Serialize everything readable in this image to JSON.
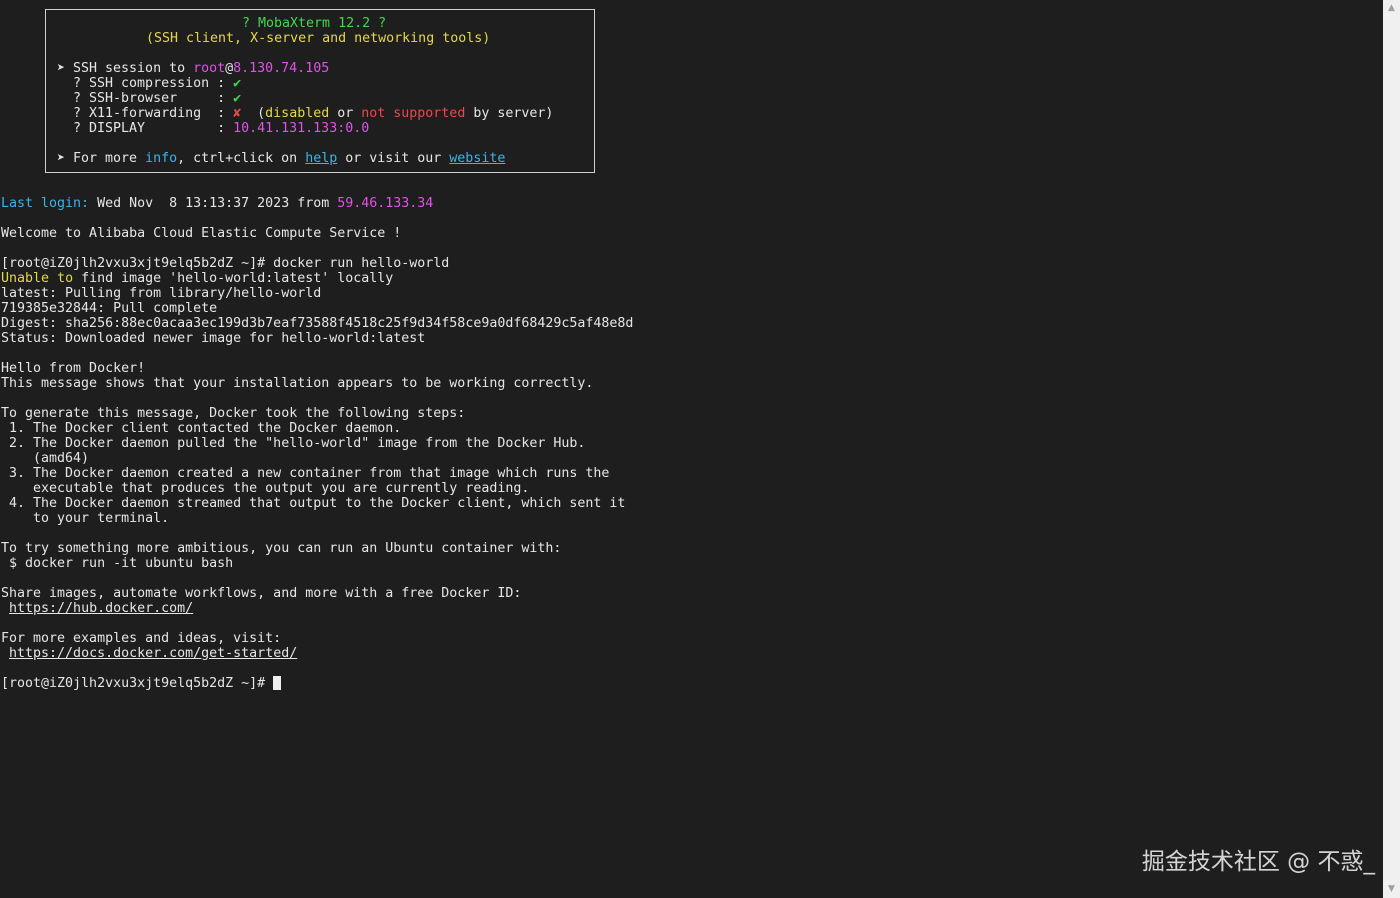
{
  "banner": {
    "title": "? MobaXterm 12.2 ?",
    "subtitle": "(SSH client, X-server and networking tools)",
    "session_prefix": "➤ SSH session to ",
    "session_user": "root",
    "session_at": "@",
    "session_host": "8.130.74.105",
    "features": [
      {
        "label": "  ? SSH compression : ",
        "status": "✔",
        "status_color": "#41d84b"
      },
      {
        "label": "  ? SSH-browser     : ",
        "status": "✔",
        "status_color": "#41d84b"
      },
      {
        "label": "  ? X11-forwarding  : ",
        "status": "✘",
        "status_color": "#e8494b"
      }
    ],
    "x11_note": {
      "open": "  (",
      "disabled": "disabled",
      "or": " or ",
      "not_supported": "not supported",
      "tail": " by server)"
    },
    "display_label": "  ? DISPLAY         : ",
    "display_value": "10.41.131.133:0.0",
    "more_prefix": "➤ For more ",
    "more_info": "info",
    "more_mid": ", ctrl+click on ",
    "help_link": "help",
    "more_mid2": " or visit our ",
    "website_link": "website"
  },
  "login": {
    "label": "Last login:",
    "date": " Wed Nov  8 13:13:37 2023 from ",
    "ip": "59.46.133.34"
  },
  "welcome": "Welcome to Alibaba Cloud Elastic Compute Service !",
  "prompt_cmd": "[root@iZ0jlh2vxu3xjt9elq5b2dZ ~]# docker run hello-world",
  "unable_word1": "Unable",
  "unable_word2": "to",
  "unable_rest": " find image 'hello-world:latest' locally",
  "output_lines": [
    "latest: Pulling from library/hello-world",
    "719385e32844: Pull complete",
    "Digest: sha256:88ec0acaa3ec199d3b7eaf73588f4518c25f9d34f58ce9a0df68429c5af48e8d",
    "Status: Downloaded newer image for hello-world:latest",
    "",
    "Hello from Docker!",
    "This message shows that your installation appears to be working correctly.",
    "",
    "To generate this message, Docker took the following steps:",
    " 1. The Docker client contacted the Docker daemon.",
    " 2. The Docker daemon pulled the \"hello-world\" image from the Docker Hub.",
    "    (amd64)",
    " 3. The Docker daemon created a new container from that image which runs the",
    "    executable that produces the output you are currently reading.",
    " 4. The Docker daemon streamed that output to the Docker client, which sent it",
    "    to your terminal.",
    "",
    "To try something more ambitious, you can run an Ubuntu container with:",
    " $ docker run -it ubuntu bash",
    "",
    "Share images, automate workflows, and more with a free Docker ID:"
  ],
  "hub_link": "https://hub.docker.com/",
  "examples_text": "For more examples and ideas, visit:",
  "docs_link": "https://docs.docker.com/get-started/",
  "final_prompt": "[root@iZ0jlh2vxu3xjt9elq5b2dZ ~]# ",
  "watermark": "掘金技术社区 @ 不惑_",
  "scroll_up_icon": "▲",
  "scroll_down_icon": "▼"
}
